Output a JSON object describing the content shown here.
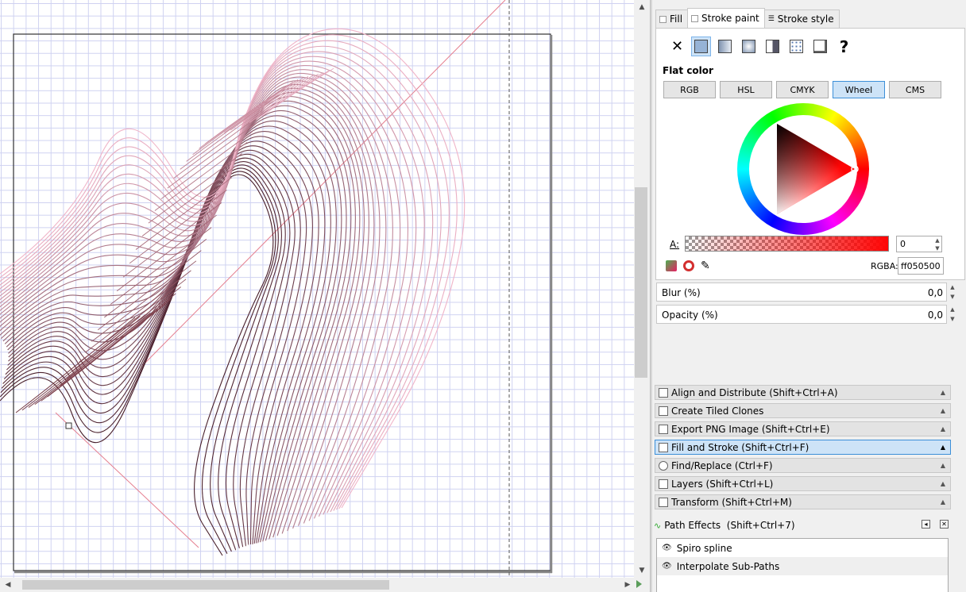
{
  "fill_stroke": {
    "tabs": [
      {
        "label": "Fill"
      },
      {
        "label": "Stroke paint"
      },
      {
        "label": "Stroke style"
      }
    ],
    "paint_types": [
      "no-paint-icon",
      "flat-color-icon",
      "linear-gradient-icon",
      "radial-gradient-icon",
      "pattern-icon",
      "swatch-icon",
      "unset-paint-icon"
    ],
    "unset_glyph": "?",
    "none_glyph": "✕",
    "flat_color_label": "Flat color",
    "color_modes": [
      "RGB",
      "HSL",
      "CMYK",
      "Wheel",
      "CMS"
    ],
    "active_mode": "Wheel",
    "alpha_label": "A:",
    "alpha_value": "0",
    "rgba_label": "RGBA:",
    "rgba_value": "ff050500",
    "blur_label": "Blur (%)",
    "blur_value": "0,0",
    "opacity_label": "Opacity (%)",
    "opacity_value": "0,0",
    "current_color": "#ff0505"
  },
  "docks": [
    {
      "label": "Align and Distribute (Shift+Ctrl+A)",
      "icon": "align-icon"
    },
    {
      "label": "Create Tiled Clones",
      "icon": "tiled-clones-icon"
    },
    {
      "label": "Export PNG Image (Shift+Ctrl+E)",
      "icon": "export-icon"
    },
    {
      "label": "Fill and Stroke (Shift+Ctrl+F)",
      "icon": "fill-stroke-icon"
    },
    {
      "label": "Find/Replace (Ctrl+F)",
      "icon": "find-icon"
    },
    {
      "label": "Layers (Shift+Ctrl+L)",
      "icon": "layers-icon"
    },
    {
      "label": "Transform (Shift+Ctrl+M)",
      "icon": "transform-icon"
    }
  ],
  "path_effects": {
    "title": "Path Effects  (Shift+Ctrl+7)",
    "items": [
      "Spiro spline",
      "Interpolate Sub-Paths"
    ]
  }
}
